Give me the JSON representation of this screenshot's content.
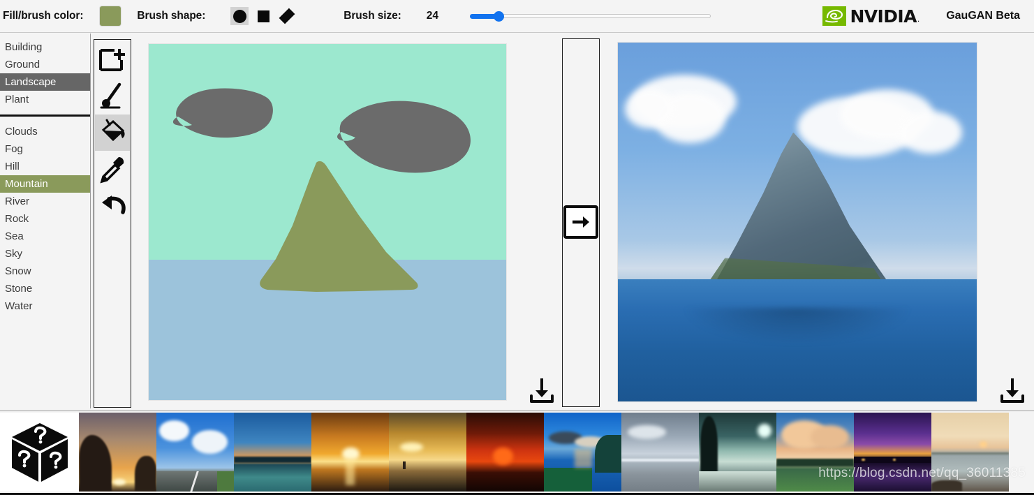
{
  "toolbar": {
    "fill_color_label": "Fill/brush color:",
    "fill_color_hex": "#8a9a5b",
    "brush_shape_label": "Brush shape:",
    "brush_shapes": [
      {
        "name": "circle",
        "selected": true
      },
      {
        "name": "square",
        "selected": false
      },
      {
        "name": "diamond",
        "selected": false
      }
    ],
    "brush_size_label": "Brush size:",
    "brush_size_value": "24",
    "brush_size_percent": 12
  },
  "brand": {
    "wordmark": "NVIDIA",
    "wordmark_dot": ".",
    "logo_color": "#76b900",
    "app_title": "GauGAN Beta"
  },
  "segment_panel": {
    "categories": [
      {
        "label": "Building",
        "selected": false
      },
      {
        "label": "Ground",
        "selected": false
      },
      {
        "label": "Landscape",
        "selected": true,
        "highlight": "#666666"
      },
      {
        "label": "Plant",
        "selected": false
      }
    ],
    "segments": [
      {
        "label": "Clouds",
        "selected": false
      },
      {
        "label": "Fog",
        "selected": false
      },
      {
        "label": "Hill",
        "selected": false
      },
      {
        "label": "Mountain",
        "selected": true,
        "highlight": "#8a9a5b"
      },
      {
        "label": "River",
        "selected": false
      },
      {
        "label": "Rock",
        "selected": false
      },
      {
        "label": "Sea",
        "selected": false
      },
      {
        "label": "Sky",
        "selected": false
      },
      {
        "label": "Snow",
        "selected": false
      },
      {
        "label": "Stone",
        "selected": false
      },
      {
        "label": "Water",
        "selected": false
      }
    ]
  },
  "tools": [
    {
      "name": "new-canvas-icon",
      "selected": false
    },
    {
      "name": "pen-icon",
      "selected": false
    },
    {
      "name": "fill-bucket-icon",
      "selected": true
    },
    {
      "name": "eyedropper-icon",
      "selected": false
    },
    {
      "name": "undo-icon",
      "selected": false
    }
  ],
  "sketch_canvas": {
    "sky_color": "#9ce8cf",
    "sea_color": "#9cc3db",
    "mountain_color": "#8a9a5b",
    "cloud_color": "#6b6b6b",
    "shapes": [
      {
        "name": "cloud-left",
        "color": "#6b6b6b"
      },
      {
        "name": "cloud-right",
        "color": "#6b6b6b"
      },
      {
        "name": "mountain",
        "color": "#8a9a5b"
      }
    ]
  },
  "generate": {
    "button_icon": "arrow-right-icon"
  },
  "output": {
    "description": "Generated mountain island over ocean with clouds"
  },
  "downloads": {
    "sketch_icon": "download-icon",
    "output_icon": "download-icon"
  },
  "filmstrip": {
    "random_label": "random-style-cube-icon",
    "thumbnails": [
      {
        "name": "style-thumb-sunset-trees",
        "c1": "#6a5a66",
        "c2": "#e8a24a",
        "c3": "#f6d27a",
        "c4": "#2a1f18"
      },
      {
        "name": "style-thumb-highway-clouds",
        "c1": "#2f78c8",
        "c2": "#8fc0e8",
        "c3": "#cfe2f2",
        "c4": "#5f6b70"
      },
      {
        "name": "style-thumb-lake-dusk",
        "c1": "#1f5f9e",
        "c2": "#3a7fb5",
        "c3": "#e8b06a",
        "c4": "#12333f"
      },
      {
        "name": "style-thumb-ocean-sunrise",
        "c1": "#7a4a18",
        "c2": "#f0a32a",
        "c3": "#fbe08a",
        "c4": "#2d1c10"
      },
      {
        "name": "style-thumb-beach-golden",
        "c1": "#6f5a2a",
        "c2": "#e8b44a",
        "c3": "#f6d88a",
        "c4": "#1f1a12"
      },
      {
        "name": "style-thumb-red-sun",
        "c1": "#2a0c06",
        "c2": "#c42a0c",
        "c3": "#f04a10",
        "c4": "#140604"
      },
      {
        "name": "style-thumb-blue-bay",
        "c1": "#1060c0",
        "c2": "#2f86d8",
        "c3": "#e8a050",
        "c4": "#0b3a2a"
      },
      {
        "name": "style-thumb-gray-shore",
        "c1": "#7b8896",
        "c2": "#aab6c2",
        "c3": "#d6dde4",
        "c4": "#6f7a84"
      },
      {
        "name": "style-thumb-snow-night",
        "c1": "#1a2a2a",
        "c2": "#3f5f5f",
        "c3": "#cfe8e0",
        "c4": "#0d1a1a"
      },
      {
        "name": "style-thumb-clouds-field",
        "c1": "#2f74b8",
        "c2": "#e8b88a",
        "c3": "#f2d4b0",
        "c4": "#3f6a3a"
      },
      {
        "name": "style-thumb-purple-dusk",
        "c1": "#3a2060",
        "c2": "#6a3a9a",
        "c3": "#e8a040",
        "c4": "#120a20"
      },
      {
        "name": "style-thumb-tide-pool",
        "c1": "#e8cfa8",
        "c2": "#f2dcb8",
        "c3": "#a8b4b8",
        "c4": "#5a5048"
      }
    ]
  },
  "watermark": {
    "text": "https://blog.csdn.net/qq_36011385"
  }
}
